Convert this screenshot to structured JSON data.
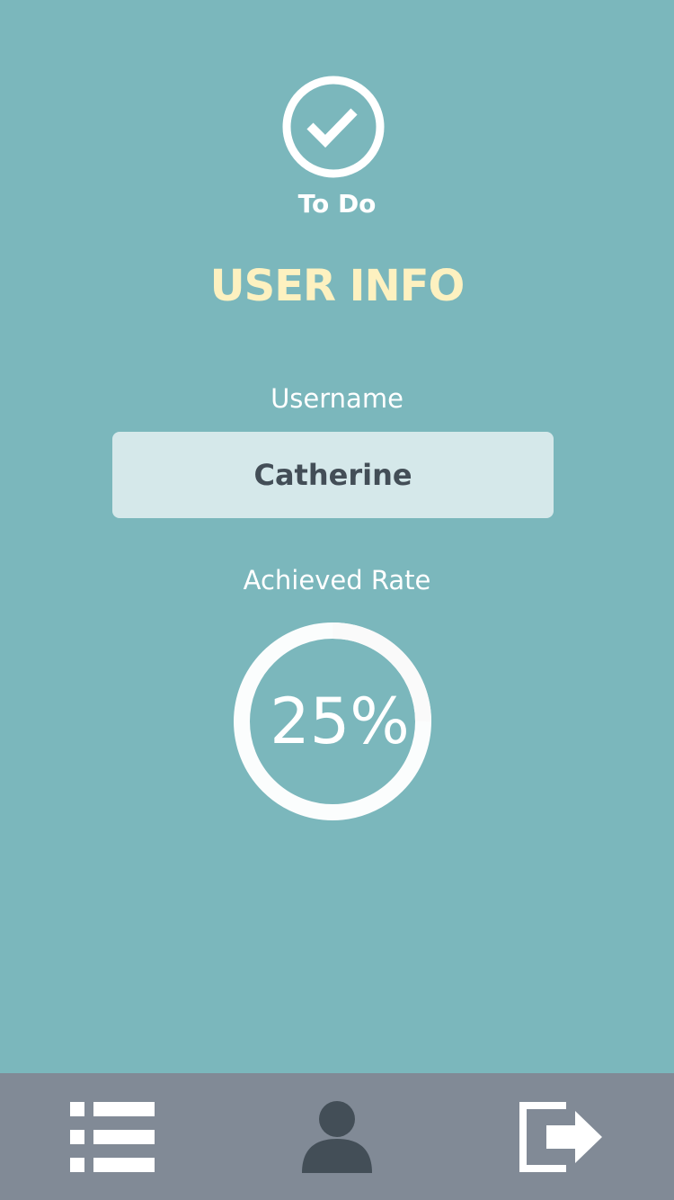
{
  "header": {
    "app_name": "To Do",
    "logo_icon": "check-circle-icon"
  },
  "section": {
    "title": "USER INFO"
  },
  "username": {
    "label": "Username",
    "value": "Catherine"
  },
  "achieved_rate": {
    "label": "Achieved Rate",
    "value_text": "25%",
    "fraction": 0.25
  },
  "tabbar": {
    "tabs": [
      {
        "icon": "list-icon",
        "selected": false
      },
      {
        "icon": "user-icon",
        "selected": true
      },
      {
        "icon": "logout-icon",
        "selected": false
      }
    ]
  },
  "colors": {
    "background": "#7bb7bc",
    "title": "#fdf1c0",
    "input_background": "#d5e8ea",
    "input_text": "#434e57",
    "tabbar": "#818a96",
    "active_icon": "#434e57",
    "inactive_icon": "#ffffff"
  }
}
